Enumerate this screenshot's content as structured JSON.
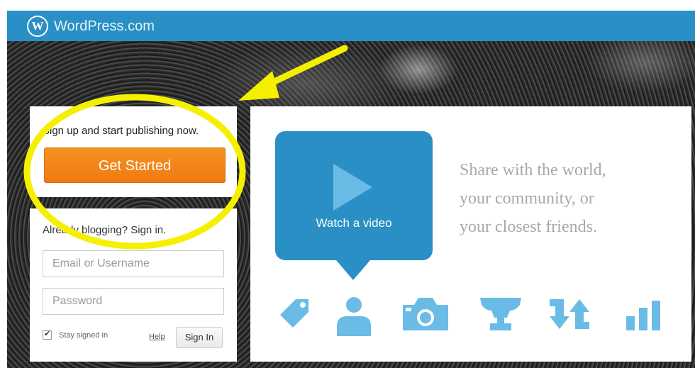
{
  "header": {
    "logo_letter": "W",
    "brand": "WordPress.com",
    "brand_color": "#2a8fc4"
  },
  "signup": {
    "prompt": "Sign up and start publishing now.",
    "button_label": "Get Started",
    "button_color": "#f6921e"
  },
  "signin": {
    "title": "Already blogging? Sign in.",
    "email_placeholder": "Email or Username",
    "password_placeholder": "Password",
    "stay_signed_in_label": "Stay signed in",
    "stay_signed_in_checked": true,
    "help_link": "Help",
    "submit_label": "Sign In"
  },
  "promo": {
    "video_label": "Watch a video",
    "tagline_lines": [
      "Share with the world,",
      "your community, or",
      "your closest friends."
    ],
    "feature_icons": [
      "tag-icon",
      "person-icon",
      "camera-icon",
      "trophy-icon",
      "arrows-icon",
      "bar-chart-icon"
    ],
    "accent_color": "#2a8fc4",
    "icon_color": "#6bbbe7"
  },
  "annotation": {
    "highlight_color": "#f4f000"
  }
}
